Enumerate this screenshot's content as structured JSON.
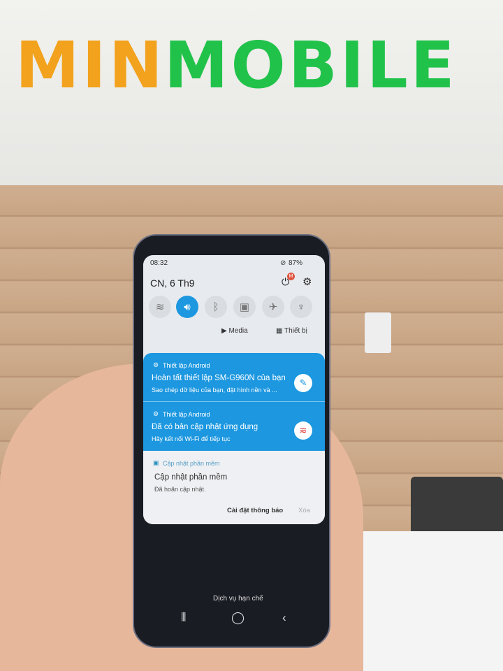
{
  "store_sign": {
    "brand_left": "MIN",
    "brand_right": "MOBILE"
  },
  "status_bar": {
    "time": "08:32",
    "battery": "87%"
  },
  "quick_panel": {
    "date": "CN, 6 Th9",
    "profile_badge": "M",
    "tiles": [
      "wifi-icon",
      "sound-icon",
      "bluetooth-icon",
      "lock-rotation-icon",
      "airplane-icon",
      "flashlight-icon"
    ],
    "media_label": "Media",
    "devices_label": "Thiết bị"
  },
  "notifications": [
    {
      "app": "Thiết lập Android",
      "title": "Hoàn tất thiết lập SM-G960N của bạn",
      "text": "Sao chép dữ liệu của bạn, đặt hình nền và ..."
    },
    {
      "app": "Thiết lập Android",
      "title": "Đã có bản cập nhật ứng dụng",
      "text": "Hãy kết nối Wi-Fi để tiếp tục"
    },
    {
      "app": "Cập nhật phần mềm",
      "title": "Cập nhật phần mềm",
      "text": "Đã hoãn cập nhật."
    }
  ],
  "actions": {
    "settings": "Cài đặt thông báo",
    "clear": "Xóa"
  },
  "lock_footer": "Dịch vụ hạn chế",
  "colors": {
    "accent": "#1c97e0",
    "brand_orange": "#f2a21c",
    "brand_green": "#21c24a"
  }
}
